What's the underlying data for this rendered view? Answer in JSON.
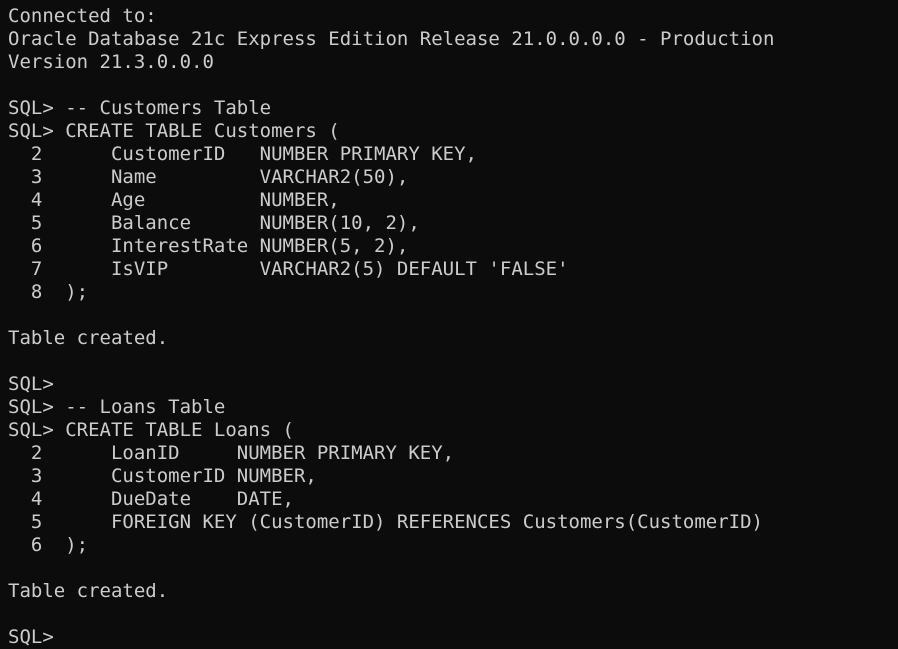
{
  "terminal": {
    "lines": [
      "Connected to:",
      "Oracle Database 21c Express Edition Release 21.0.0.0.0 - Production",
      "Version 21.3.0.0.0",
      "",
      "SQL> -- Customers Table",
      "SQL> CREATE TABLE Customers (",
      "  2      CustomerID   NUMBER PRIMARY KEY,",
      "  3      Name         VARCHAR2(50),",
      "  4      Age          NUMBER,",
      "  5      Balance      NUMBER(10, 2),",
      "  6      InterestRate NUMBER(5, 2),",
      "  7      IsVIP        VARCHAR2(5) DEFAULT 'FALSE'",
      "  8  );",
      "",
      "Table created.",
      "",
      "SQL>",
      "SQL> -- Loans Table",
      "SQL> CREATE TABLE Loans (",
      "  2      LoanID     NUMBER PRIMARY KEY,",
      "  3      CustomerID NUMBER,",
      "  4      DueDate    DATE,",
      "  5      FOREIGN KEY (CustomerID) REFERENCES Customers(CustomerID)",
      "  6  );",
      "",
      "Table created.",
      "",
      "SQL>"
    ]
  },
  "colors": {
    "background": "#0c0c0c",
    "text": "#cccccc"
  }
}
